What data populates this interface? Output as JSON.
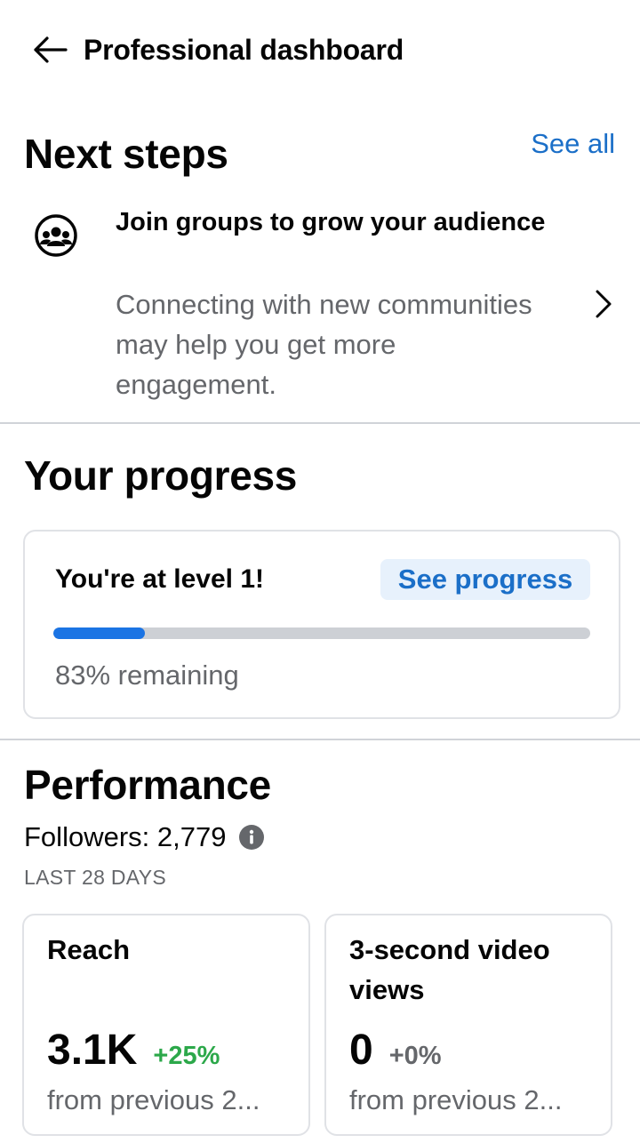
{
  "header": {
    "title": "Professional dashboard"
  },
  "next_steps": {
    "title": "Next steps",
    "see_all": "See all",
    "item": {
      "icon": "groups-icon",
      "title": "Join groups to grow your audience",
      "description": "Connecting with new communities may help you get more engagement."
    }
  },
  "progress": {
    "title": "Your progress",
    "level_text": "You're at level 1!",
    "see_progress": "See progress",
    "remaining": "83% remaining",
    "progress_fraction": 0.17,
    "accent_color": "#1b74e4"
  },
  "performance": {
    "title": "Performance",
    "followers": "Followers: 2,779",
    "period": "LAST 28 DAYS",
    "metrics": [
      {
        "label": "Reach",
        "value": "3.1K",
        "delta": "+25%",
        "delta_color": "#2ca84a",
        "sub": "from previous 2..."
      },
      {
        "label": "3-second video views",
        "value": "0",
        "delta": "+0%",
        "delta_color": "#65676b",
        "sub": "from previous 2..."
      }
    ]
  },
  "colors": {
    "link": "#1b6fc8",
    "secondary_text": "#65676b",
    "divider": "#d0d3d8"
  }
}
